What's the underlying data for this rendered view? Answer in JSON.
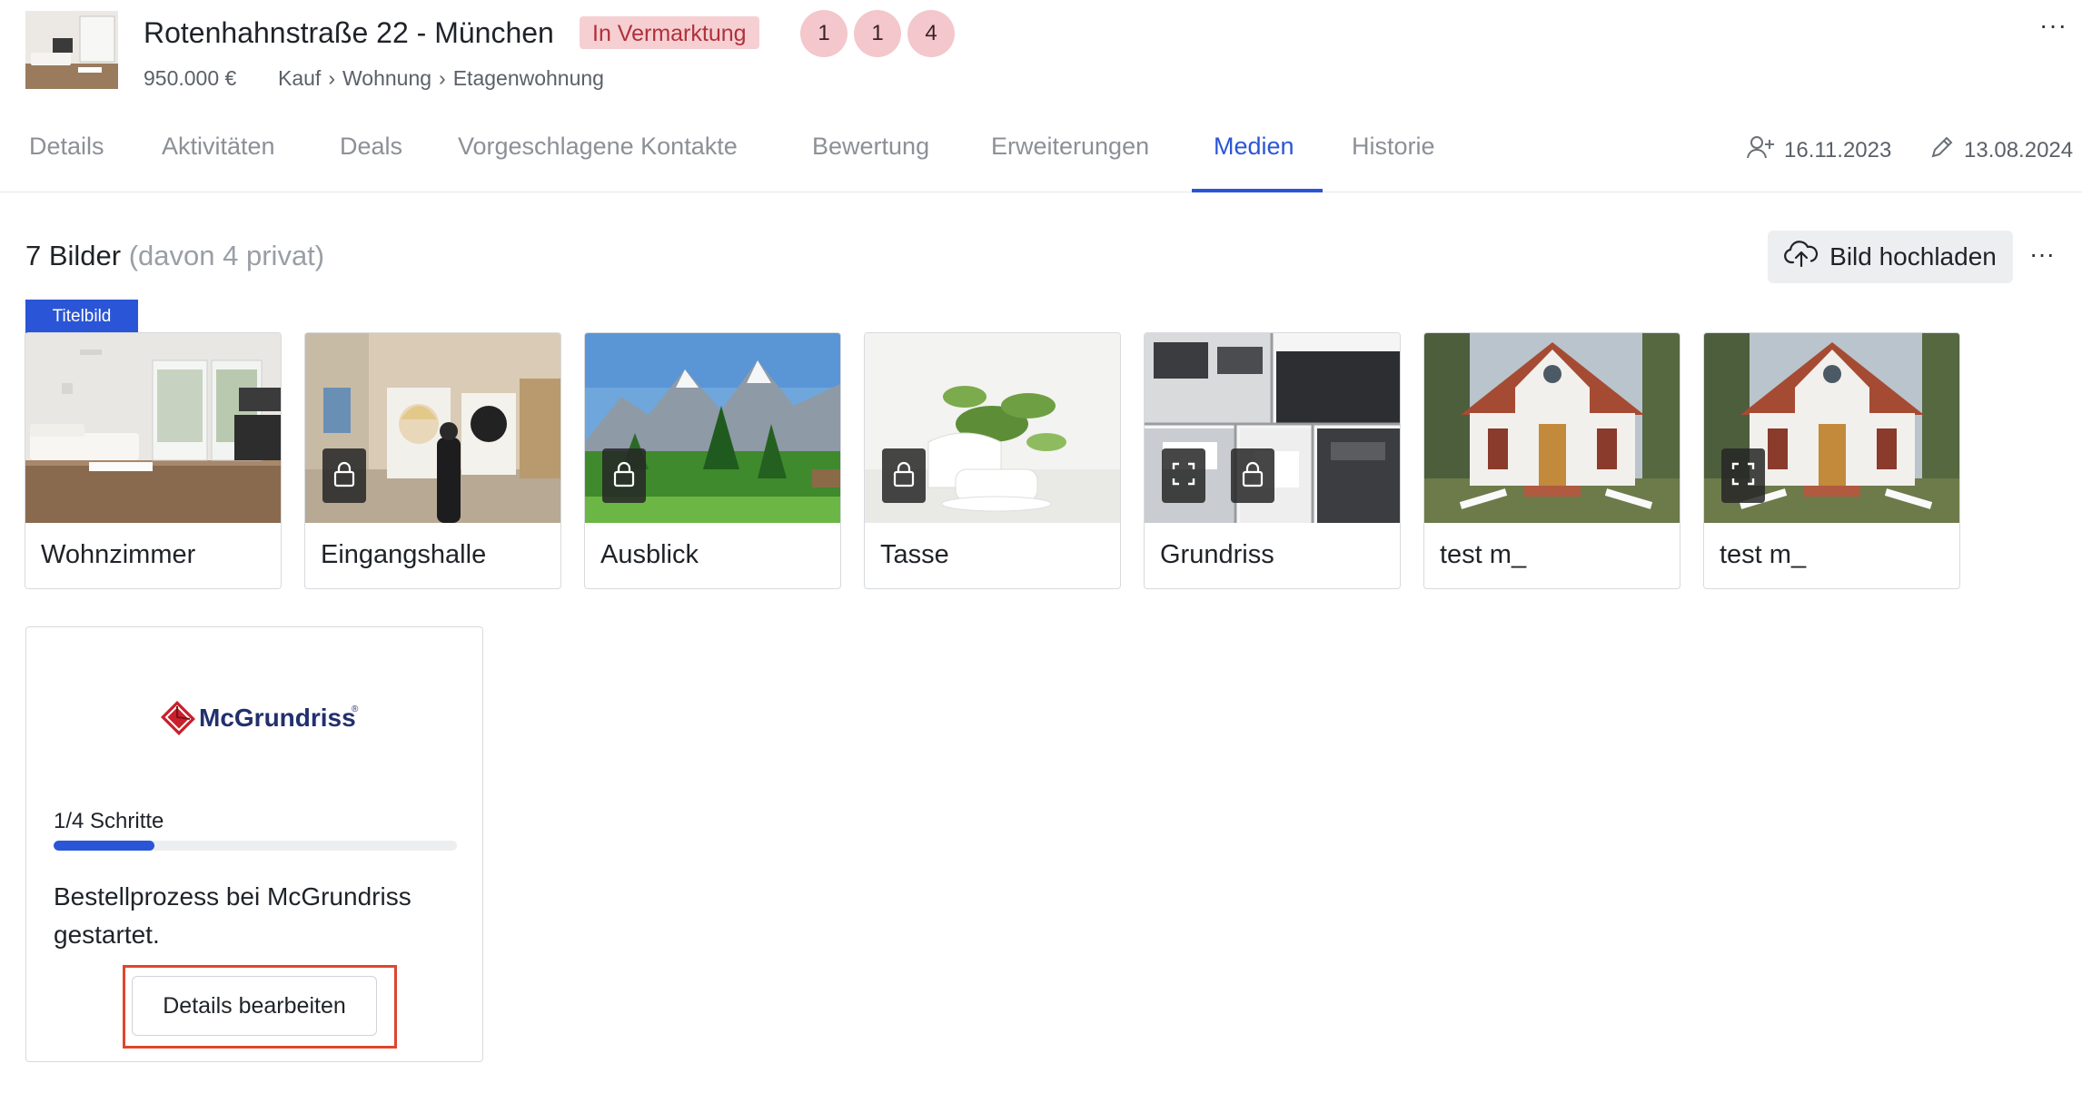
{
  "property": {
    "title": "Rotenhahnstraße 22 - München",
    "status": "In Vermarktung",
    "counts": [
      "1",
      "1",
      "4"
    ],
    "price": "950.000 €",
    "breadcrumb": [
      "Kauf",
      "Wohnung",
      "Etagenwohnung"
    ],
    "breadcrumb_sep": "›",
    "more": "···"
  },
  "tabs": [
    {
      "label": "Details"
    },
    {
      "label": "Aktivitäten"
    },
    {
      "label": "Deals"
    },
    {
      "label": "Vorgeschlagene Kontakte"
    },
    {
      "label": "Bewertung"
    },
    {
      "label": "Erweiterungen"
    },
    {
      "label": "Medien",
      "active": true
    },
    {
      "label": "Historie"
    }
  ],
  "meta": {
    "created": "16.11.2023",
    "created_icon": "user-add-icon",
    "modified": "13.08.2024",
    "modified_icon": "pencil-icon"
  },
  "images": {
    "count_label": "7 Bilder",
    "private_label": "(davon 4 privat)",
    "upload_label": "Bild hochladen",
    "upload_icon": "cloud-upload-icon",
    "more": "···",
    "title_badge": "Titelbild",
    "items": [
      {
        "label": "Wohnzimmer",
        "icons": []
      },
      {
        "label": "Eingangshalle",
        "icons": [
          "lock-icon"
        ]
      },
      {
        "label": "Ausblick",
        "icons": [
          "lock-icon"
        ]
      },
      {
        "label": "Tasse",
        "icons": [
          "lock-icon"
        ]
      },
      {
        "label": "Grundriss",
        "icons": [
          "expand-icon",
          "lock-icon"
        ]
      },
      {
        "label": "test m_",
        "icons": []
      },
      {
        "label": "test m_",
        "icons": [
          "expand-icon"
        ]
      }
    ]
  },
  "mcgrundriss": {
    "logo_text": "McGrundriss",
    "logo_mark": "®",
    "steps_label": "1/4 Schritte",
    "progress": 0.25,
    "description": "Bestellprozess bei McGrundriss gestartet.",
    "button_label": "Details bearbeiten"
  },
  "colors": {
    "accent": "#2a55d6",
    "status_bg": "#f6cfd3",
    "status_text": "#b0313a",
    "highlight": "#e0452e"
  }
}
